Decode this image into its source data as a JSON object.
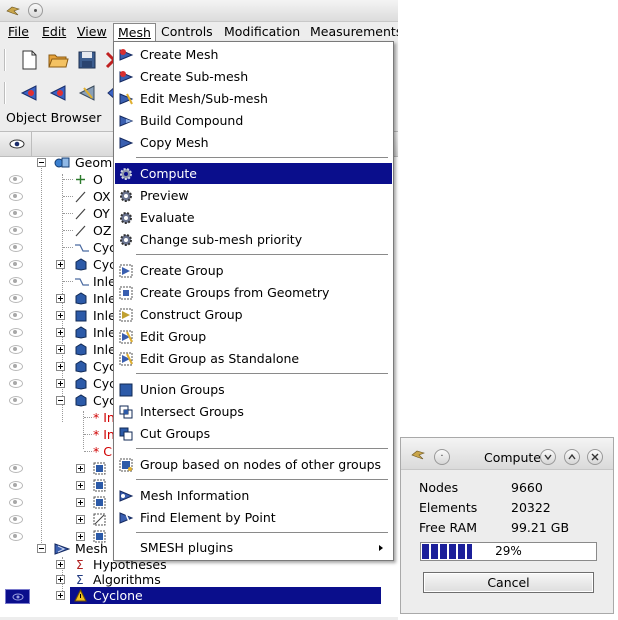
{
  "menubar": {
    "file": "File",
    "edit": "Edit",
    "view": "View",
    "mesh": "Mesh",
    "controls": "Controls",
    "modification": "Modification",
    "measurements": "Measurements"
  },
  "object_browser": {
    "label": "Object Browser"
  },
  "tree": {
    "geometry": "Geom",
    "o": "O",
    "ox": "OX",
    "oy": "OY",
    "oz": "OZ",
    "row_cyc_a": "Cyc",
    "row_cyc_b": "Cyc",
    "row_inle_a": "Inle",
    "row_inle_b": "Inle",
    "row_inle_c": "Inle",
    "row_inle_d": "Inle",
    "row_inle_e": "Inle",
    "row_cyc_c": "Cyc",
    "row_cyc_d": "Cyc",
    "row_cyc_e": "Cyc",
    "sub_a": "* In",
    "sub_b": "* In",
    "sub_c": "* C",
    "mesh": "Mesh",
    "hypotheses": "Hypotheses",
    "algorithms": "Algorithms",
    "cyclone": "Cyclone"
  },
  "mesh_menu": {
    "items": [
      "Create Mesh",
      "Create Sub-mesh",
      "Edit Mesh/Sub-mesh",
      "Build Compound",
      "Copy Mesh",
      "Compute",
      "Preview",
      "Evaluate",
      "Change sub-mesh priority",
      "Create Group",
      "Create Groups from Geometry",
      "Construct Group",
      "Edit Group",
      "Edit Group as Standalone",
      "Union Groups",
      "Intersect Groups",
      "Cut Groups",
      "Group based on nodes of other groups",
      "Mesh Information",
      "Find Element by Point",
      "SMESH plugins"
    ],
    "active_item": "Compute"
  },
  "compute_dialog": {
    "title": "Compute",
    "nodes_label": "Nodes",
    "nodes_value": "9660",
    "elements_label": "Elements",
    "elements_value": "20322",
    "ram_label": "Free RAM",
    "ram_value": "99.21 GB",
    "progress_percent": 29,
    "progress_text": "29%",
    "cancel_label": "Cancel"
  },
  "colors": {
    "selection": "#0a0e8c",
    "menu_bg": "#ffffff",
    "window_bg": "#ededed",
    "error_text": "#d00000"
  }
}
